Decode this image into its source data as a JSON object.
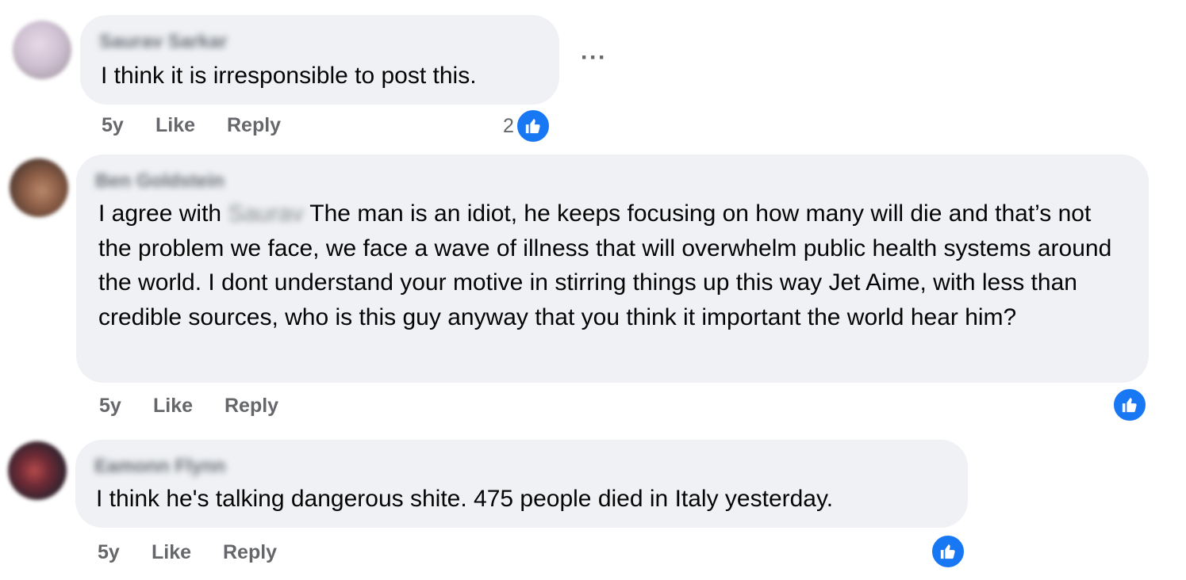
{
  "comments": [
    {
      "author": "Saurav Sarkar",
      "text": "I think it is irresponsible to post this.",
      "time": "5y",
      "like_label": "Like",
      "reply_label": "Reply",
      "reaction_count": "2",
      "reaction_icon": "like-icon"
    },
    {
      "author": "Ben Goldstein",
      "text_prefix": "I agree with",
      "mention": "Saurav",
      "text": "The man is an idiot, he keeps focusing on how many will die and that’s not the problem we face, we face a wave of illness that will overwhelm public health systems around the world. I dont understand your motive in stirring things up this way Jet Aime, with less than credible sources, who is this guy anyway that you think it important the world hear him?",
      "time": "5y",
      "like_label": "Like",
      "reply_label": "Reply",
      "reaction_icon": "like-icon"
    },
    {
      "author": "Eamonn Flynn",
      "text": "I think he's talking dangerous shite. 475 people died in Italy yesterday.",
      "time": "5y",
      "like_label": "Like",
      "reply_label": "Reply",
      "reaction_icon": "like-icon"
    }
  ],
  "menu": {
    "more_label": "···"
  },
  "colors": {
    "bubble": "#eff1f4",
    "like_blue": "#1877f2",
    "meta_gray": "#65676b"
  }
}
